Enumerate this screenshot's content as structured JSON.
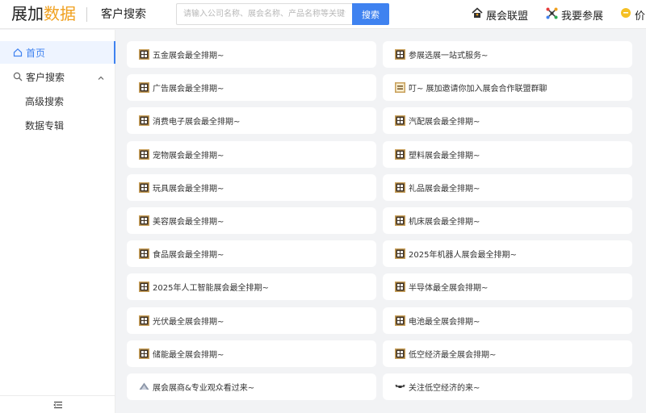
{
  "header": {
    "logo_main": "展加",
    "logo_accent": "数据",
    "title": "客户搜索",
    "search_placeholder": "请输入公司名称、展会名称、产品名称等关键词",
    "search_button": "搜索",
    "nav_alliance": "展会联盟",
    "nav_exhibit": "我要参展",
    "nav_price": "价"
  },
  "sidebar": {
    "home": "首页",
    "customer_search": "客户搜索",
    "advanced_search": "高级搜索",
    "data_topics": "数据专辑"
  },
  "cards": [
    {
      "label": "五金展会最全排期~",
      "icon": "grid-icon"
    },
    {
      "label": "参展选展一站式服务~",
      "icon": "grid-icon"
    },
    {
      "label": "广告展会最全排期~",
      "icon": "grid-icon"
    },
    {
      "label": "叮~ 展加邀请你加入展会合作联盟群聊",
      "icon": "alliance-badge-icon"
    },
    {
      "label": "消费电子展会最全排期~",
      "icon": "grid-icon"
    },
    {
      "label": "汽配展会最全排期~",
      "icon": "grid-icon"
    },
    {
      "label": "宠物展会最全排期~",
      "icon": "grid-icon"
    },
    {
      "label": "塑料展会最全排期~",
      "icon": "grid-icon"
    },
    {
      "label": "玩具展会最全排期~",
      "icon": "grid-icon"
    },
    {
      "label": "礼品展会最全排期~",
      "icon": "grid-icon"
    },
    {
      "label": "美容展会最全排期~",
      "icon": "grid-icon"
    },
    {
      "label": "机床展会最全排期~",
      "icon": "grid-icon"
    },
    {
      "label": "食品展会最全排期~",
      "icon": "grid-icon"
    },
    {
      "label": "2025年机器人展会最全排期~",
      "icon": "grid-icon"
    },
    {
      "label": "2025年人工智能展会最全排期~",
      "icon": "grid-icon"
    },
    {
      "label": "半导体最全展会排期~",
      "icon": "grid-icon"
    },
    {
      "label": "光伏最全展会排期~",
      "icon": "grid-icon"
    },
    {
      "label": "电池最全展会排期~",
      "icon": "grid-icon"
    },
    {
      "label": "储能最全展会排期~",
      "icon": "grid-icon"
    },
    {
      "label": "低空经济最全展会排期~",
      "icon": "grid-icon"
    },
    {
      "label": "展会展商&专业观众看过来~",
      "icon": "triangle-logo-icon"
    },
    {
      "label": "关注低空经济的来~",
      "icon": "drone-icon"
    }
  ],
  "colors": {
    "accent": "#3f82f0",
    "logo_accent": "#f0a01e"
  }
}
